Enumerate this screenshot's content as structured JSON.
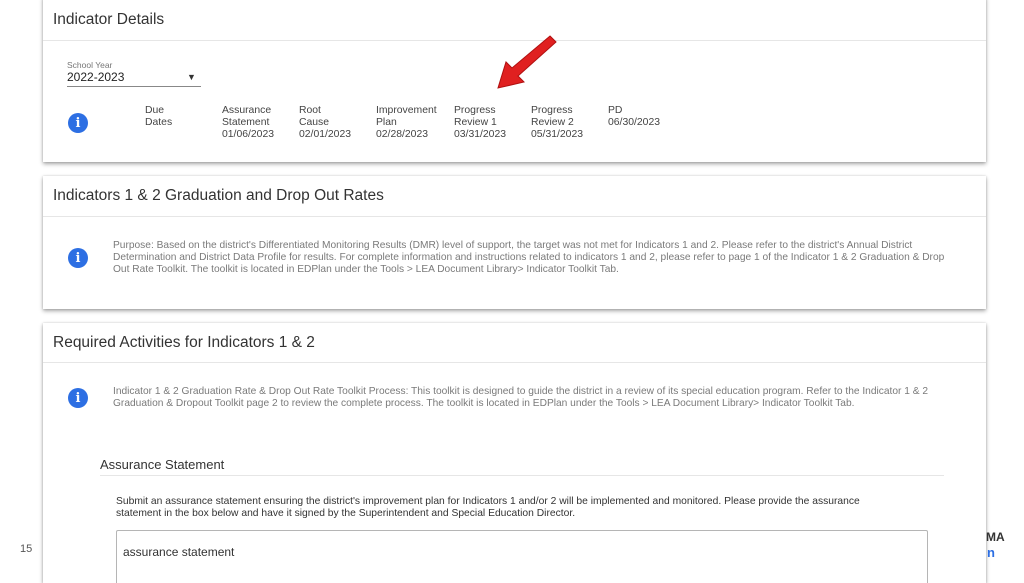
{
  "slide_number": "15",
  "brand_fragment": {
    "top": "MA",
    "bottom": "n"
  },
  "indicator_details": {
    "title": "Indicator Details",
    "school_year_label": "School Year",
    "school_year_value": "2022-2023",
    "due_dates_label": "Due Dates",
    "dates": [
      {
        "label": "Assurance\nStatement\n01/06/2023"
      },
      {
        "label": "Root Cause\n02/01/2023"
      },
      {
        "label": "Improvement\nPlan\n02/28/2023"
      },
      {
        "label": "Progress\nReview 1\n03/31/2023"
      },
      {
        "label": "Progress\nReview 2\n05/31/2023"
      },
      {
        "label": "PD\n06/30/2023"
      }
    ]
  },
  "graduation_section": {
    "title": "Indicators 1 & 2 Graduation and Drop Out Rates",
    "purpose": "Purpose: Based on the district's Differentiated Monitoring Results (DMR) level of support, the target was not met for Indicators 1 and 2. Please refer to the district's Annual District Determination and District Data Profile for results. For complete information and instructions related to indicators 1 and 2, please refer to page 1 of the Indicator 1 & 2 Graduation & Drop Out Rate Toolkit. The toolkit is located in EDPlan under the Tools > LEA Document Library> Indicator Toolkit Tab."
  },
  "required_activities": {
    "title": "Required Activities for Indicators 1 & 2",
    "process_note": "Indicator 1 & 2 Graduation Rate & Drop Out Rate Toolkit Process: This toolkit is designed to guide the district in a review of its special education program. Refer to the Indicator 1 & 2 Graduation & Dropout Toolkit page 2 to review the complete process. The toolkit is located in EDPlan under the Tools > LEA Document Library> Indicator Toolkit Tab.",
    "assurance_heading": "Assurance Statement",
    "assurance_instructions": "Submit an assurance statement ensuring the district's improvement plan for Indicators 1 and/or 2 will be implemented and monitored. Please provide the assurance statement in the box below and have it signed by the Superintendent and Special Education Director.",
    "assurance_input_value": "assurance statement"
  },
  "colors": {
    "info_icon": "#2d6fe3",
    "arrow": "#e02020"
  },
  "icons": {
    "info": "info-icon",
    "dropdown": "chevron-down-icon",
    "pointer": "red-arrow-icon"
  }
}
